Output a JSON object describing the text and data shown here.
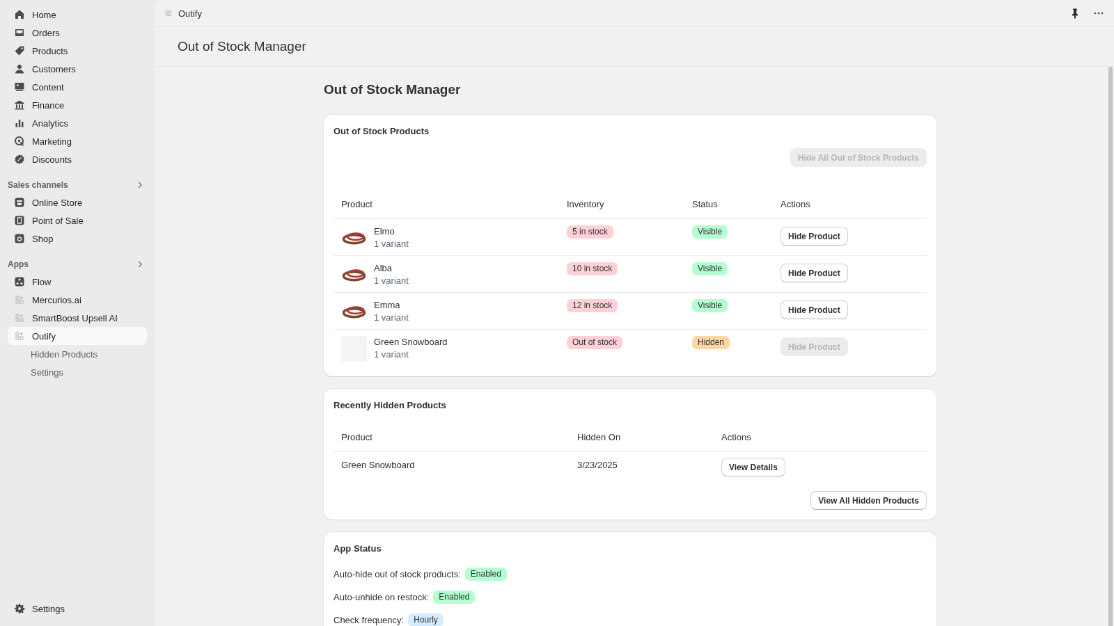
{
  "sidebar": {
    "main_items": [
      {
        "label": "Home",
        "selected": false
      },
      {
        "label": "Orders",
        "selected": false
      },
      {
        "label": "Products",
        "selected": false
      },
      {
        "label": "Customers",
        "selected": false
      },
      {
        "label": "Content",
        "selected": false
      },
      {
        "label": "Finance",
        "selected": false
      },
      {
        "label": "Analytics",
        "selected": false
      },
      {
        "label": "Marketing",
        "selected": false
      },
      {
        "label": "Discounts",
        "selected": false
      }
    ],
    "sections": [
      {
        "title": "Sales channels",
        "items": [
          {
            "label": "Online Store",
            "kind": "channel",
            "selected": false
          },
          {
            "label": "Point of Sale",
            "kind": "channel",
            "selected": false
          },
          {
            "label": "Shop",
            "kind": "channel",
            "selected": false
          }
        ]
      },
      {
        "title": "Apps",
        "items": [
          {
            "label": "Flow",
            "kind": "channel",
            "selected": false
          },
          {
            "label": "Mercurios.ai",
            "kind": "app",
            "selected": false
          },
          {
            "label": "SmartBoost Upsell AI",
            "kind": "app",
            "selected": false
          },
          {
            "label": "Outify",
            "kind": "app",
            "selected": true,
            "children": [
              {
                "label": "Hidden Products",
                "selected": false
              },
              {
                "label": "Settings",
                "selected": false
              }
            ]
          }
        ]
      }
    ],
    "footer_item": {
      "label": "Settings"
    }
  },
  "top_bar": {
    "app_name": "Outify"
  },
  "page_header": {
    "title": "Out of Stock Manager"
  },
  "content": {
    "title": "Out of Stock Manager",
    "out_of_stock": {
      "title": "Out of Stock Products",
      "bulk_button": {
        "label": "Hide All Out of Stock Products",
        "disabled": true
      },
      "columns": [
        "Product",
        "Inventory",
        "Status",
        "Actions"
      ],
      "rows": [
        {
          "name": "Elmo",
          "variants": "1 variant",
          "kind": "photo",
          "inventory": {
            "label": "5 in stock",
            "color": "#fed1d7"
          },
          "status": {
            "label": "Visible",
            "color": "#b4fed2"
          },
          "action": {
            "label": "Hide Product",
            "disabled": false
          }
        },
        {
          "name": "Alba",
          "variants": "1 variant",
          "kind": "photo",
          "inventory": {
            "label": "10 in stock",
            "color": "#fed1d7"
          },
          "status": {
            "label": "Visible",
            "color": "#b4fed2"
          },
          "action": {
            "label": "Hide Product",
            "disabled": false
          }
        },
        {
          "name": "Emma",
          "variants": "1 variant",
          "kind": "photo",
          "inventory": {
            "label": "12 in stock",
            "color": "#fed1d7"
          },
          "status": {
            "label": "Visible",
            "color": "#b4fed2"
          },
          "action": {
            "label": "Hide Product",
            "disabled": false
          }
        },
        {
          "name": "Green Snowboard",
          "variants": "1 variant",
          "kind": "empty",
          "inventory": {
            "label": "Out of stock",
            "color": "#fed1d7"
          },
          "status": {
            "label": "Hidden",
            "color": "#ffd6a4"
          },
          "action": {
            "label": "Hide Product",
            "disabled": true
          }
        }
      ]
    },
    "recently_hidden": {
      "title": "Recently Hidden Products",
      "columns": [
        "Product",
        "Hidden On",
        "Actions"
      ],
      "rows": [
        {
          "product": "Green Snowboard",
          "hidden_on": "3/23/2025",
          "action": "View Details"
        }
      ],
      "footer_button": "View All Hidden Products"
    },
    "app_status": {
      "title": "App Status",
      "items": [
        {
          "label": "Auto-hide out of stock products:",
          "badge": {
            "label": "Enabled",
            "color": "#b4fed2"
          }
        },
        {
          "label": "Auto-unhide on restock:",
          "badge": {
            "label": "Enabled",
            "color": "#b4fed2"
          }
        },
        {
          "label": "Check frequency:",
          "badge": {
            "label": "Hourly",
            "color": "#d5ebff"
          }
        }
      ]
    }
  }
}
